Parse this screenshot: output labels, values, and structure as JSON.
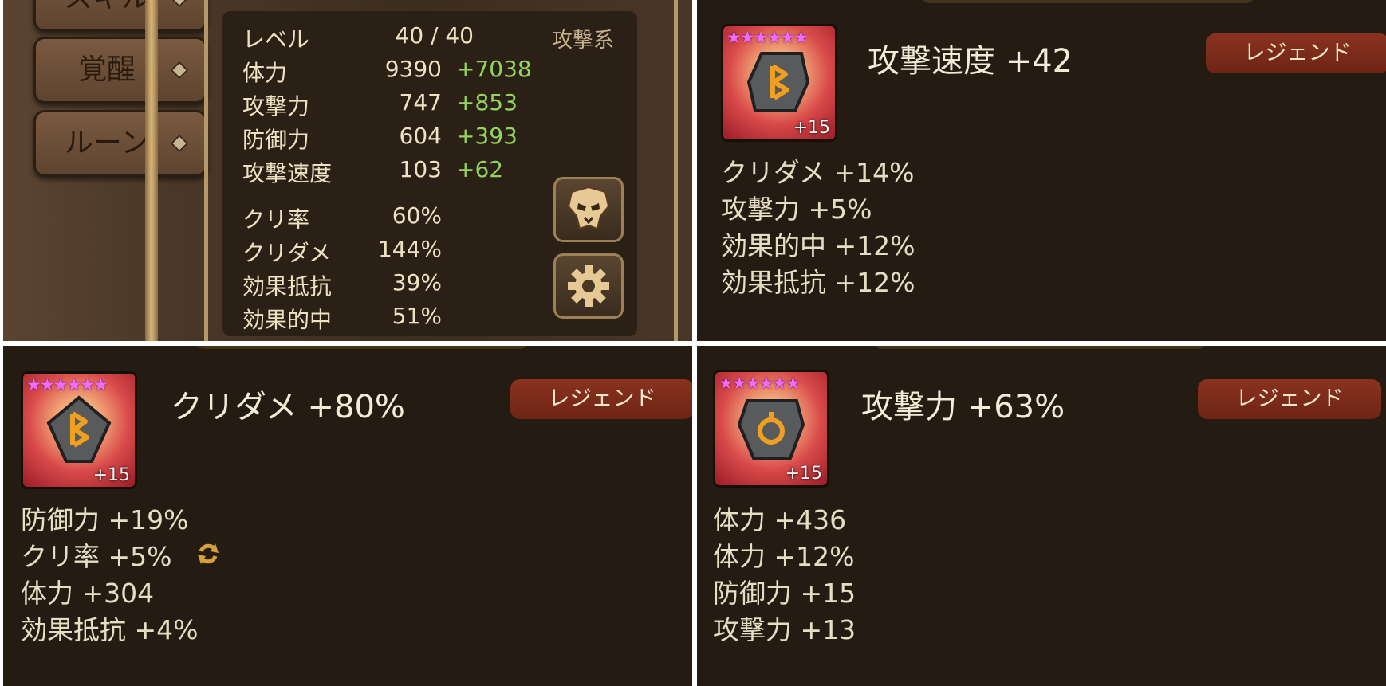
{
  "left_nav": {
    "skill_label": "スキル",
    "awaken_label": "覚醒",
    "rune_label": "ルーン"
  },
  "stats": {
    "type_label": "攻撃系",
    "rows": [
      {
        "label": "レベル",
        "value": "40 / 40",
        "bonus": ""
      },
      {
        "label": "体力",
        "value": "9390",
        "bonus": "+7038"
      },
      {
        "label": "攻撃力",
        "value": "747",
        "bonus": "+853"
      },
      {
        "label": "防御力",
        "value": "604",
        "bonus": "+393"
      },
      {
        "label": "攻撃速度",
        "value": "103",
        "bonus": "+62"
      },
      {
        "label": "クリ率",
        "value": "60%",
        "bonus": ""
      },
      {
        "label": "クリダメ",
        "value": "144%",
        "bonus": ""
      },
      {
        "label": "効果抵抗",
        "value": "39%",
        "bonus": ""
      },
      {
        "label": "効果的中",
        "value": "51%",
        "bonus": ""
      }
    ],
    "buttons": {
      "monster_icon": "monster-mask-icon",
      "settings_icon": "gear-icon"
    }
  },
  "runes": [
    {
      "stars": "★★★★★★",
      "level": "+15",
      "main_stat": "攻撃速度 +42",
      "grade": "レジェンド",
      "substats": [
        "クリダメ +14%",
        "攻撃力 +5%",
        "効果的中 +12%",
        "効果抵抗 +12%"
      ],
      "colors": {
        "grade_bg": "#7c2a18",
        "stars": "#f06cff"
      }
    },
    {
      "stars": "★★★★★★",
      "level": "+15",
      "main_stat": "クリダメ +80%",
      "grade": "レジェンド",
      "substats": [
        "防御力 +19%",
        "クリ率 +5%",
        "体力 +304",
        "効果抵抗 +4%"
      ],
      "refreshed_icon": "refresh-icon"
    },
    {
      "stars": "★★★★★★",
      "level": "+15",
      "main_stat": "攻撃力 +63%",
      "grade": "レジェンド",
      "substats": [
        "体力 +436",
        "体力 +12%",
        "防御力 +15",
        "攻撃力 +13"
      ]
    }
  ]
}
